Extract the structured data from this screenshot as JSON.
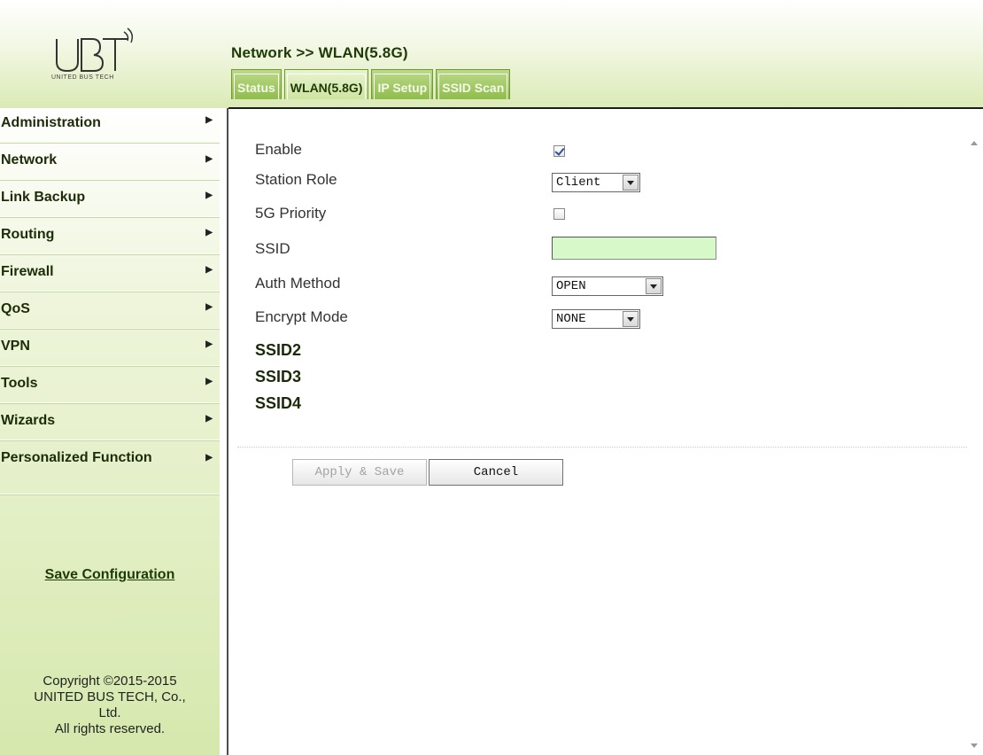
{
  "logo": {
    "text": "UNITED BUS TECH"
  },
  "header": {
    "title": "Network >> WLAN(5.8G)"
  },
  "tabs": [
    {
      "label": "Status"
    },
    {
      "label": "WLAN(5.8G)"
    },
    {
      "label": "IP Setup"
    },
    {
      "label": "SSID Scan"
    }
  ],
  "active_tab": "WLAN(5.8G)",
  "sidebar": {
    "items": [
      {
        "label": "Administration"
      },
      {
        "label": "Network"
      },
      {
        "label": "Link Backup"
      },
      {
        "label": "Routing"
      },
      {
        "label": "Firewall"
      },
      {
        "label": "QoS"
      },
      {
        "label": "VPN"
      },
      {
        "label": "Tools"
      },
      {
        "label": "Wizards"
      },
      {
        "label": "Personalized Function"
      }
    ],
    "arrow": "▶",
    "save_label": "Save Configuration",
    "copyright": [
      "Copyright ©2015-2015",
      "UNITED BUS TECH, Co.,",
      "Ltd.",
      "All rights reserved."
    ]
  },
  "form": {
    "enable": {
      "label": "Enable",
      "checked": true
    },
    "station_role": {
      "label": "Station Role",
      "value": "Client"
    },
    "priority_5g": {
      "label": "5G Priority",
      "checked": false
    },
    "ssid": {
      "label": "SSID",
      "value": ""
    },
    "auth_method": {
      "label": "Auth Method",
      "value": "OPEN"
    },
    "encrypt_mode": {
      "label": "Encrypt Mode",
      "value": "NONE"
    },
    "sections": [
      "SSID2",
      "SSID3",
      "SSID4"
    ]
  },
  "buttons": {
    "apply": "Apply & Save",
    "cancel": "Cancel"
  },
  "colors": {
    "accent": "#8fbd4c",
    "title": "#1e3a06",
    "ssid_input": "#d7f9c9"
  }
}
